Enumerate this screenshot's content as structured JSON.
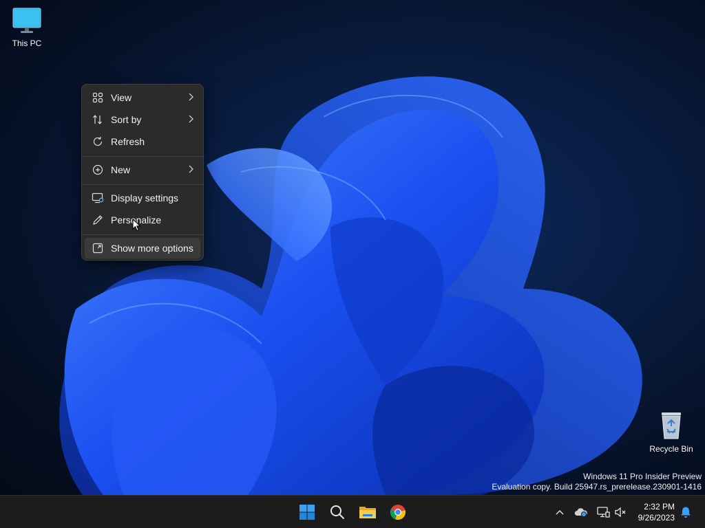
{
  "desktop": {
    "icons": {
      "this_pc": "This PC",
      "recycle_bin": "Recycle Bin"
    },
    "watermark": {
      "line1": "Windows 11 Pro Insider Preview",
      "line2": "Evaluation copy. Build 25947.rs_prerelease.230901-1416"
    }
  },
  "context_menu": {
    "items": [
      {
        "label": "View",
        "icon": "view-grid-icon",
        "submenu": true
      },
      {
        "label": "Sort by",
        "icon": "sort-icon",
        "submenu": true
      },
      {
        "label": "Refresh",
        "icon": "refresh-icon",
        "submenu": false
      },
      {
        "label": "New",
        "icon": "add-circle-icon",
        "submenu": true
      },
      {
        "label": "Display settings",
        "icon": "display-settings-icon",
        "submenu": false
      },
      {
        "label": "Personalize",
        "icon": "pen-icon",
        "submenu": false
      },
      {
        "label": "Show more options",
        "icon": "share-expand-icon",
        "submenu": false
      }
    ],
    "hovered": "Show more options"
  },
  "taskbar": {
    "apps": [
      "start-icon",
      "search-icon",
      "file-explorer-icon",
      "chrome-icon"
    ],
    "tray": [
      "chevron-up-icon",
      "onedrive-icon",
      "network-icon",
      "volume-muted-icon"
    ],
    "clock": {
      "time": "2:32 PM",
      "date": "9/26/2023"
    }
  },
  "colors": {
    "accent": "#0067c0",
    "menu_bg": "#2b2b2b",
    "taskbar_bg": "#1c1c1c"
  }
}
